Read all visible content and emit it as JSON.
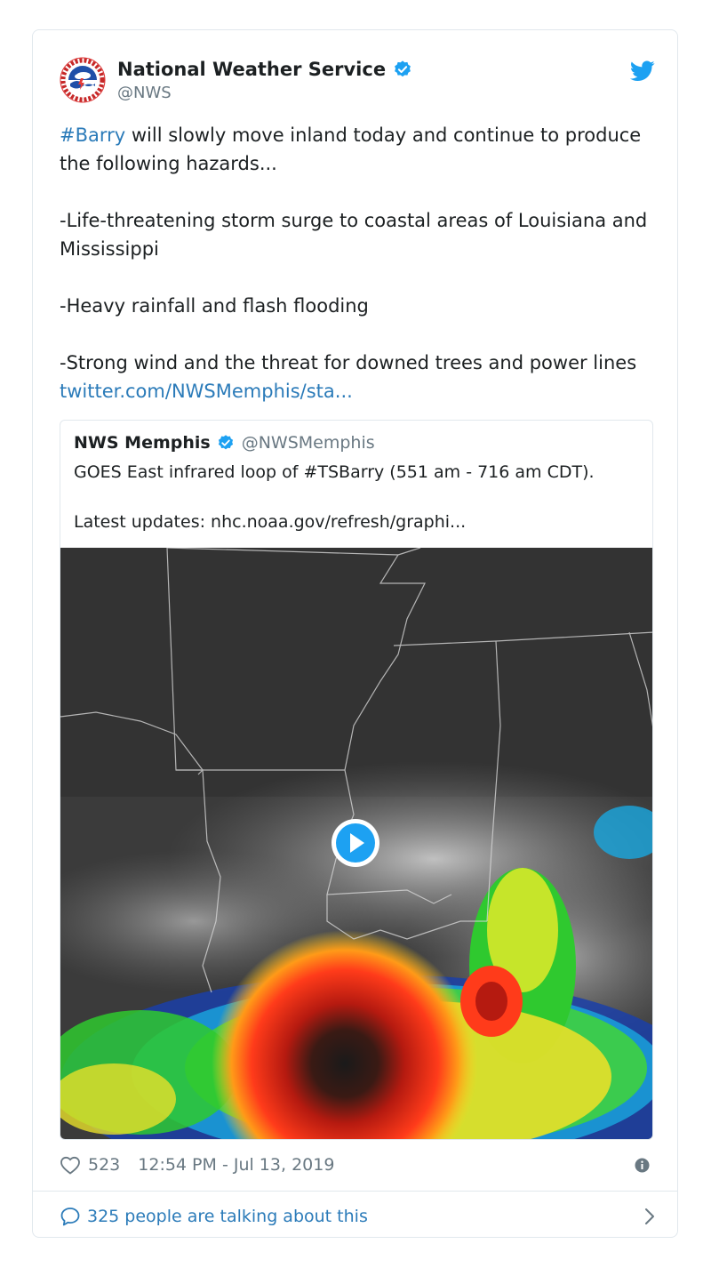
{
  "author": {
    "name": "National Weather Service",
    "handle": "@NWS"
  },
  "tweet": {
    "hashtag": "#Barry",
    "line1_rest": " will slowly move inland today and continue to produce the following hazards...",
    "hazard1": "-Life-threatening storm surge to coastal areas of Louisiana and Mississippi",
    "hazard2": "-Heavy rainfall and flash flooding",
    "hazard3_text": "-Strong wind and the threat for downed trees and power lines ",
    "link": "twitter.com/NWSMemphis/sta..."
  },
  "quoted": {
    "name": "NWS Memphis",
    "handle": "@NWSMemphis",
    "text1": "GOES East infrared loop of #TSBarry (551 am - 716 am CDT).",
    "text2": "Latest updates: nhc.noaa.gov/refresh/graphi..."
  },
  "footer": {
    "likes": "523",
    "timestamp": "12:54 PM - Jul 13, 2019",
    "talking": "325 people are talking about this"
  },
  "icons": {
    "verified": "verified-badge-icon",
    "twitter": "twitter-bird-icon",
    "like": "heart-icon",
    "info": "info-icon",
    "reply": "speech-bubble-icon",
    "chevron": "chevron-right-icon",
    "play": "play-icon"
  },
  "colors": {
    "link": "#2b7bb9",
    "verified": "#1da1f2",
    "muted": "#697882",
    "border": "#e1e8ed"
  }
}
